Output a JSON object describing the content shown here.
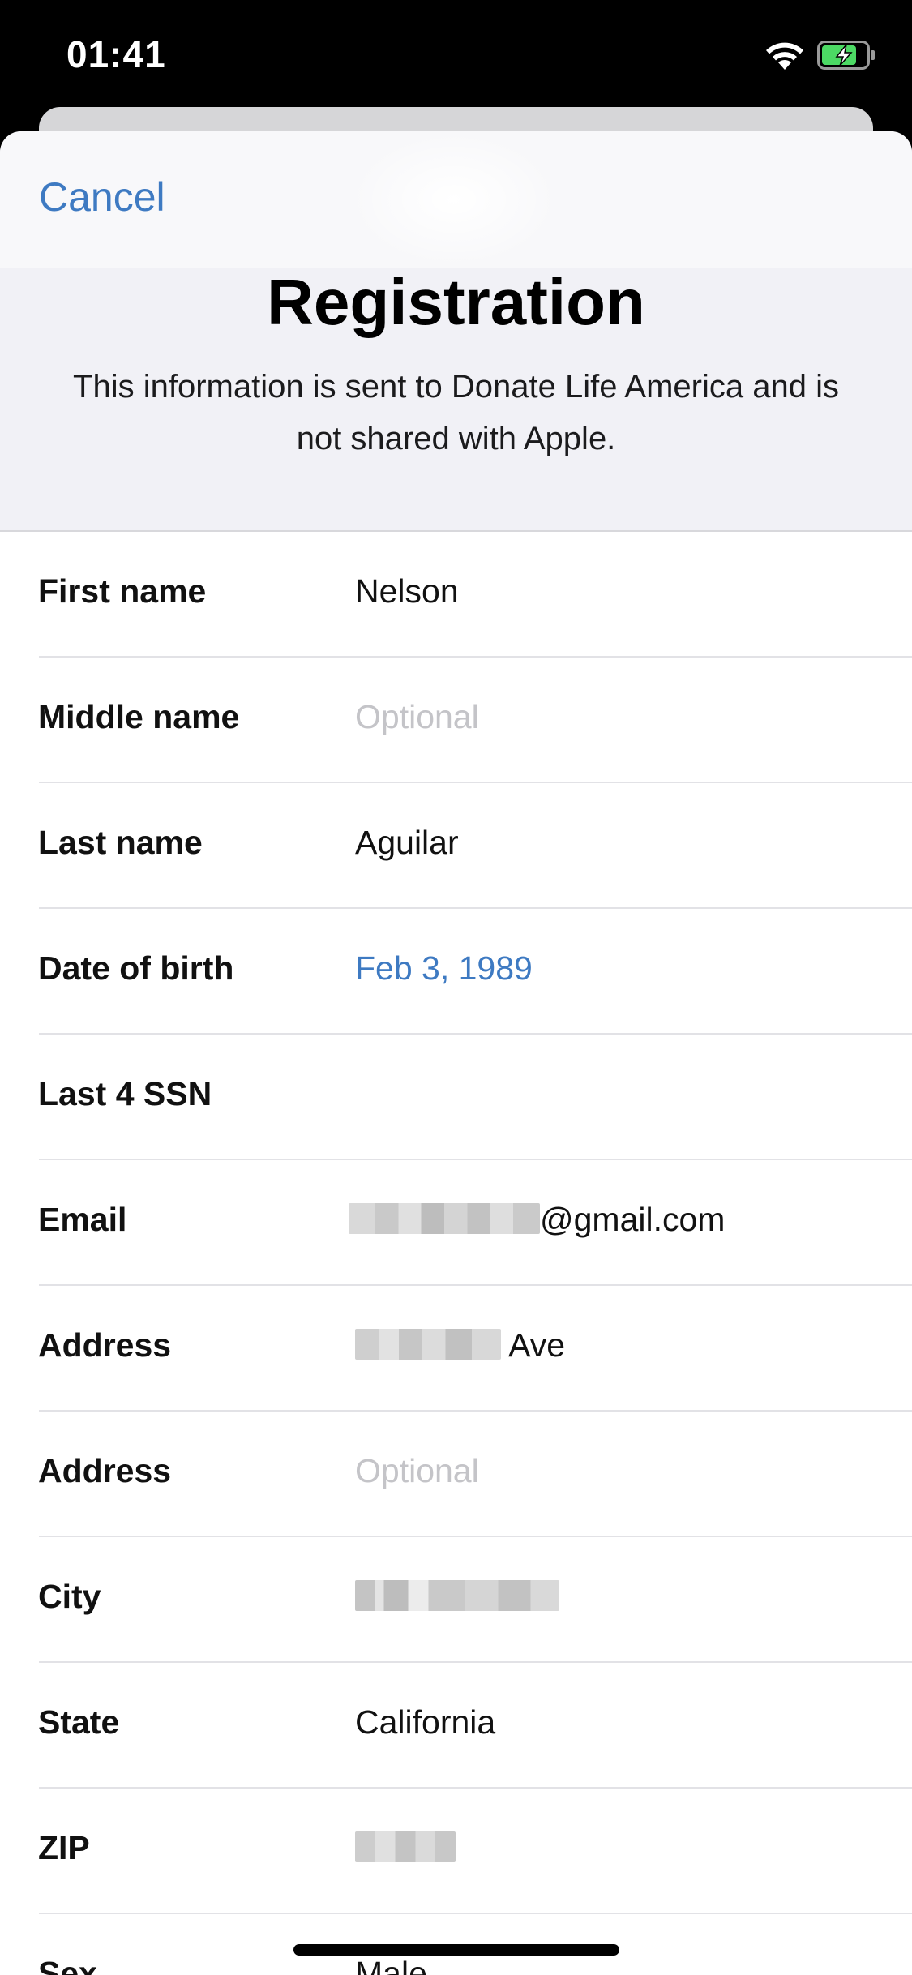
{
  "status_bar": {
    "time": "01:41",
    "wifi_icon": "wifi-icon",
    "battery_icon": "battery-charging-icon",
    "battery_color": "#4cd964"
  },
  "nav": {
    "cancel_label": "Cancel"
  },
  "header": {
    "title": "Registration",
    "subtitle": "This information is sent to Donate Life America and is not shared with Apple."
  },
  "form": {
    "rows": [
      {
        "label": "First name",
        "value": "Nelson"
      },
      {
        "label": "Middle name",
        "placeholder": "Optional"
      },
      {
        "label": "Last name",
        "value": "Aguilar"
      },
      {
        "label": "Date of birth",
        "value": "Feb 3, 1989"
      },
      {
        "label": "Last 4 SSN",
        "value": ""
      },
      {
        "label": "Email",
        "value": "@gmail.com",
        "redacted": true
      },
      {
        "label": "Address",
        "value": "Ave",
        "redacted": true
      },
      {
        "label": "Address",
        "placeholder": "Optional"
      },
      {
        "label": "City",
        "redacted": true
      },
      {
        "label": "State",
        "value": "California"
      },
      {
        "label": "ZIP",
        "redacted": true
      },
      {
        "label": "Sex",
        "value": "Male"
      }
    ]
  },
  "colors": {
    "accent": "#3e7ac2",
    "placeholder": "#c4c4c8",
    "sheet_background": "#f1f1f6"
  }
}
